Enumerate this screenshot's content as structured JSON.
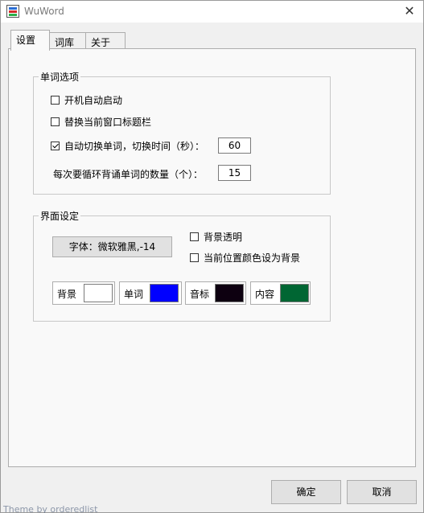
{
  "window": {
    "title": "WuWord",
    "close_glyph": "✕"
  },
  "tabs": [
    {
      "label": "设置"
    },
    {
      "label": "词库"
    },
    {
      "label": "关于"
    }
  ],
  "word_options": {
    "title": "单词选项",
    "autostart": {
      "label": "开机自动启动",
      "checked": false
    },
    "replace_titlebar": {
      "label": "替换当前窗口标题栏",
      "checked": false
    },
    "auto_switch": {
      "label": "自动切换单词，切换时间（秒）：",
      "checked": true,
      "value": "60"
    },
    "loop_count": {
      "label": "每次要循环背诵单词的数量（个）：",
      "value": "15"
    }
  },
  "ui_settings": {
    "title": "界面设定",
    "font_button": "字体：微软雅黑,-14",
    "transparent_bg": {
      "label": "背景透明",
      "checked": false
    },
    "position_color_bg": {
      "label": "当前位置颜色设为背景",
      "checked": false
    },
    "colors": [
      {
        "label": "背景",
        "color": "#ffffff"
      },
      {
        "label": "单词",
        "color": "#0000ff"
      },
      {
        "label": "音标",
        "color": "#0d0010"
      },
      {
        "label": "内容",
        "color": "#006633"
      }
    ]
  },
  "footer": {
    "ok": "确定",
    "cancel": "取消"
  },
  "ghost_text": "Theme by orderedlist"
}
